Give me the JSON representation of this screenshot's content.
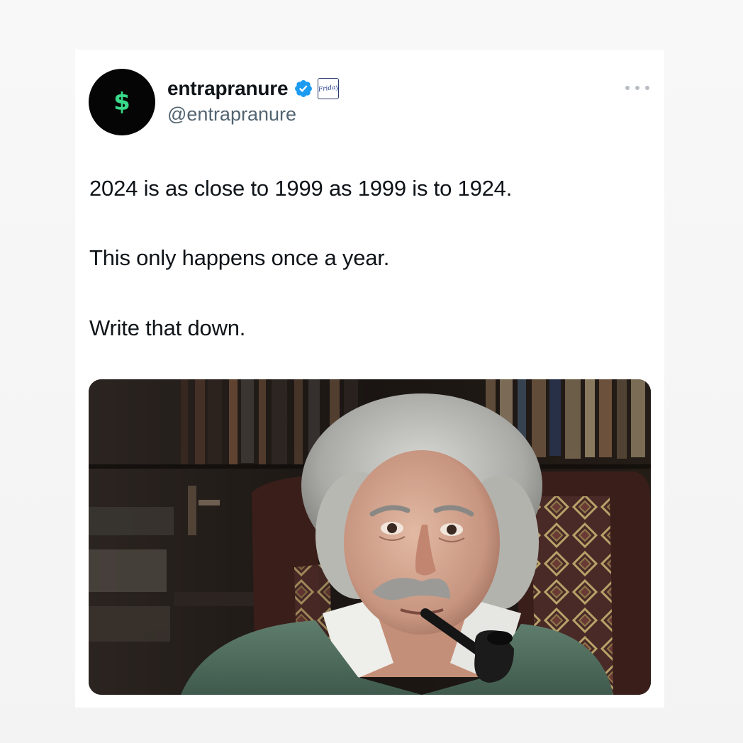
{
  "tweet": {
    "avatar_symbol": "$",
    "display_name": "entrapranure",
    "handle": "@entrapranure",
    "verified_icon": "verified-badge-icon",
    "affiliation_badge_text": "Friday",
    "more_icon": "more-options-icon",
    "text_lines": [
      "2024 is as close to 1999 as 1999 is to 1924.",
      "This only happens once a year.",
      "Write that down."
    ],
    "media_alt": "Photo of an elderly man with wild white hair and mustache, smoking a pipe, in a green sweater, seated in an ornate chair in front of bookshelves"
  },
  "colors": {
    "avatar_bg": "#050505",
    "avatar_symbol": "#39d98a",
    "verified_blue": "#1d9bf0",
    "text_primary": "#0f1419",
    "text_secondary": "#536471"
  }
}
